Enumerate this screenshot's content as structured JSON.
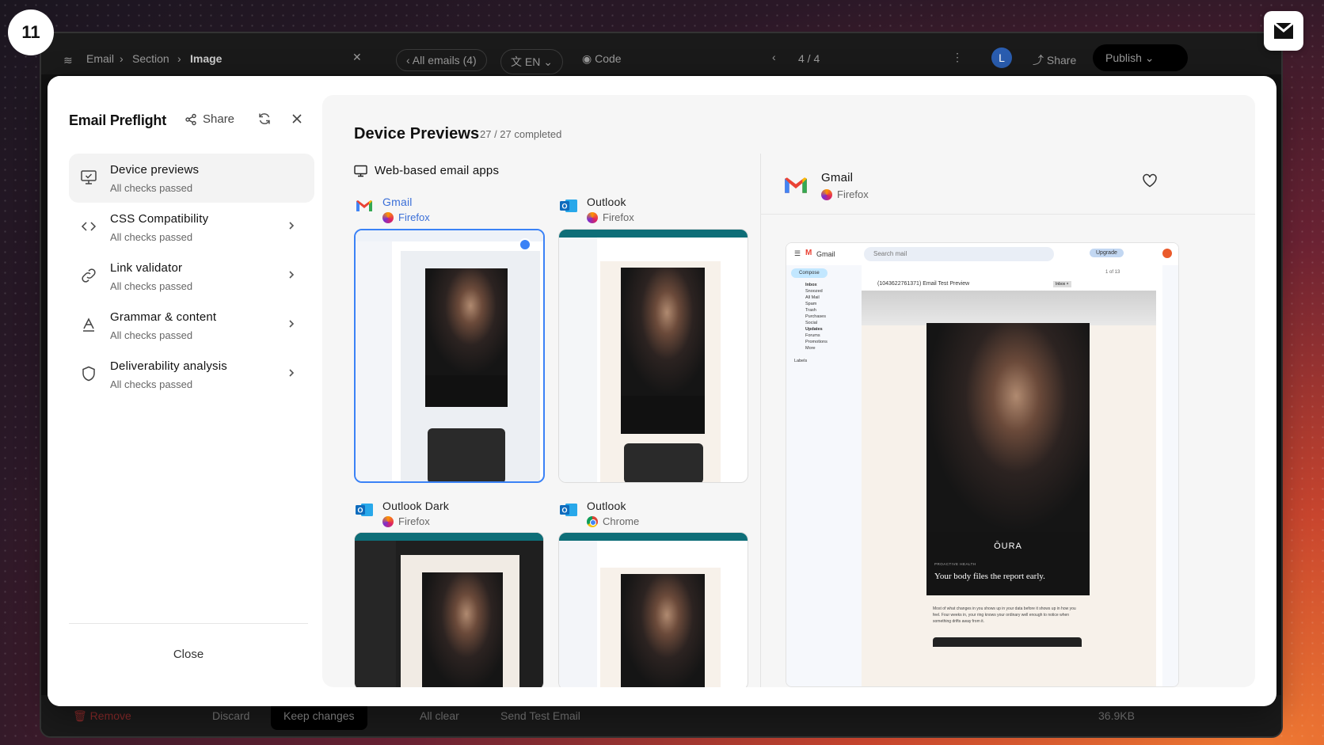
{
  "step_badge": "11",
  "background_app": {
    "breadcrumb": [
      "Email",
      "Section",
      "Image"
    ],
    "all_emails": "All emails (4)",
    "language": "EN",
    "code": "Code",
    "pager": "4 / 4",
    "avatar_initial": "L",
    "share": "Share",
    "publish": "Publish",
    "remove": "Remove",
    "discard": "Discard",
    "keep_changes": "Keep changes",
    "all_clear": "All clear",
    "send_test": "Send Test Email",
    "size": "36.9KB"
  },
  "preflight": {
    "title": "Email Preflight",
    "share_label": "Share",
    "close_label": "Close",
    "nav": [
      {
        "label": "Device previews",
        "status": "All checks passed",
        "icon": "monitor-check-icon"
      },
      {
        "label": "CSS Compatibility",
        "status": "All checks passed",
        "icon": "code-icon"
      },
      {
        "label": "Link validator",
        "status": "All checks passed",
        "icon": "link-icon"
      },
      {
        "label": "Grammar & content",
        "status": "All checks passed",
        "icon": "spellcheck-icon"
      },
      {
        "label": "Deliverability analysis",
        "status": "All checks passed",
        "icon": "shield-icon"
      }
    ]
  },
  "previews": {
    "title": "Device Previews",
    "progress": "27 / 27 completed",
    "completed": 27,
    "total": 27,
    "section": "Web-based email apps",
    "cards": [
      {
        "client": "Gmail",
        "browser": "Firefox",
        "selected": true
      },
      {
        "client": "Outlook",
        "browser": "Firefox",
        "selected": false
      },
      {
        "client": "Outlook Dark",
        "browser": "Firefox",
        "selected": false
      },
      {
        "client": "Outlook",
        "browser": "Chrome",
        "selected": false
      }
    ]
  },
  "detail": {
    "client": "Gmail",
    "browser": "Firefox",
    "gmail_ui": {
      "app_name": "Gmail",
      "search_placeholder": "Search mail",
      "upgrade": "Upgrade",
      "compose": "Compose",
      "folders": [
        "Inbox",
        "Snoozed",
        "All Mail",
        "Spam",
        "Trash",
        "Purchases",
        "Social",
        "Updates",
        "Forums",
        "Promotions",
        "More"
      ],
      "labels": "Labels",
      "subject": "(1043622761371) Email Test Preview",
      "inbox_tag": "Inbox ×",
      "count": "1 of 13"
    },
    "email": {
      "brand": "ŌURA",
      "eyebrow": "PROACTIVE HEALTH",
      "headline": "Your body files the report early.",
      "body": "Most of what changes in you shows up in your data before it shows up in how you feel. Four weeks in, your ring knows your ordinary well enough to notice when something drifts away from it."
    }
  },
  "colors": {
    "accent": "#3b82f6",
    "gmail_red": "#ea4335",
    "outlook_blue": "#0f6cbd"
  }
}
